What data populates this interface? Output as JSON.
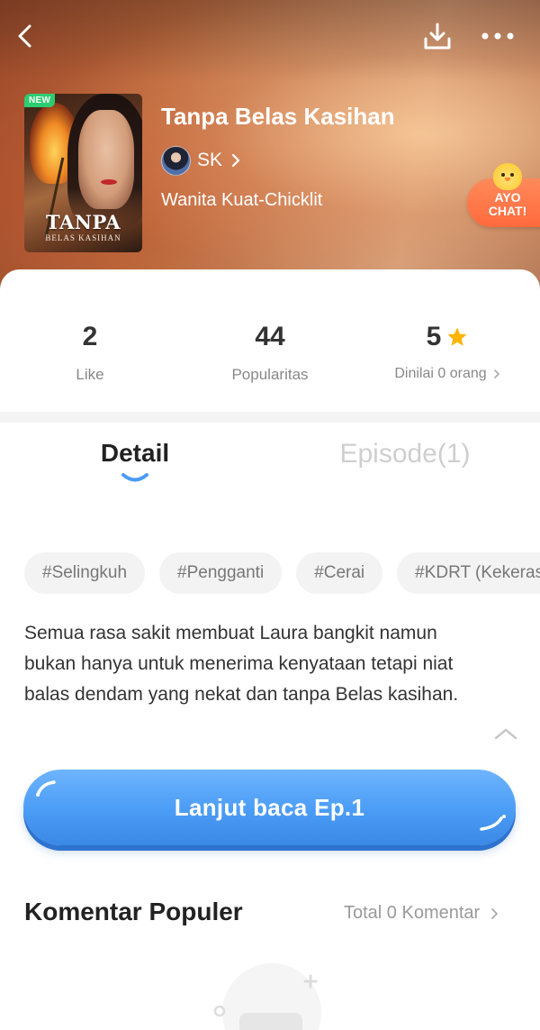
{
  "header": {
    "back_icon": "back-arrow-icon",
    "download_icon": "download-icon",
    "more_icon": "more-dots-icon"
  },
  "book": {
    "cover_badge": "NEW",
    "cover_title": "TANPA",
    "cover_subtitle": "BELAS KASIHAN",
    "title": "Tanpa Belas Kasihan",
    "author": "SK",
    "genre": "Wanita Kuat-Chicklit"
  },
  "ayo_chat": {
    "label_line1": "AYO",
    "label_line2": "CHAT!"
  },
  "stats": [
    {
      "value": "2",
      "label": "Like"
    },
    {
      "value": "44",
      "label": "Popularitas"
    },
    {
      "value": "5",
      "label": "Dinilai 0 orang"
    }
  ],
  "tabs": {
    "detail": "Detail",
    "episode": "Episode(1)"
  },
  "tags": [
    "#Selingkuh",
    "#Pengganti",
    "#Cerai",
    "#KDRT (Kekerasan)"
  ],
  "synopsis": "Semua rasa sakit membuat Laura bangkit namun bukan hanya untuk menerima kenyataan tetapi niat balas dendam yang nekat dan tanpa Belas kasihan.",
  "read_button": "Lanjut baca Ep.1",
  "comments": {
    "title": "Komentar Populer",
    "total": "Total 0 Komentar"
  },
  "colors": {
    "accent_blue": "#4a9cf5",
    "star": "#ffb400",
    "ayo_orange": "#ff6a3d"
  }
}
